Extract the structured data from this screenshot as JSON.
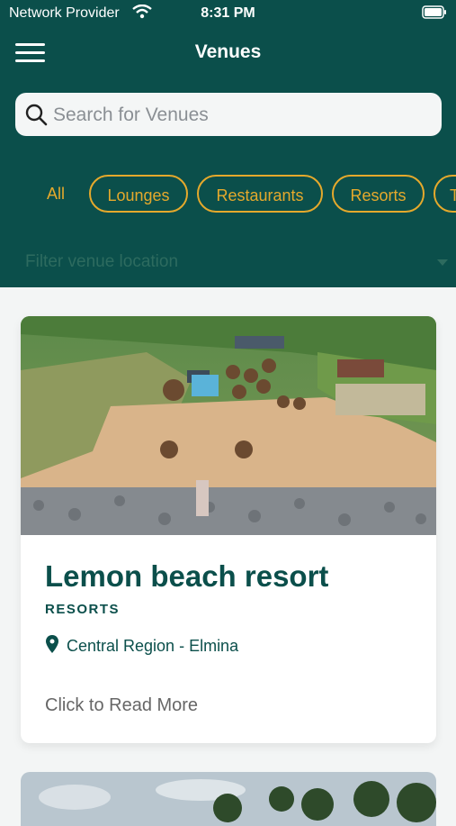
{
  "status_bar": {
    "carrier": "Network Provider",
    "time": "8:31 PM"
  },
  "header": {
    "title": "Venues"
  },
  "search": {
    "placeholder": "Search for Venues",
    "value": ""
  },
  "categories": [
    "All",
    "Lounges",
    "Restaurants",
    "Resorts",
    "T"
  ],
  "filter": {
    "placeholder": "Filter venue location"
  },
  "venues": [
    {
      "name": "Lemon beach resort",
      "category": "RESORTS",
      "location": "Central Region - Elmina",
      "cta": "Click to Read More"
    }
  ],
  "colors": {
    "primary": "#0b4f4b",
    "accent": "#e5a92c",
    "background": "#f3f5f5"
  },
  "icons": [
    "menu-icon",
    "search-icon",
    "wifi-icon",
    "battery-icon",
    "location-pin-icon",
    "dropdown-caret-icon"
  ]
}
